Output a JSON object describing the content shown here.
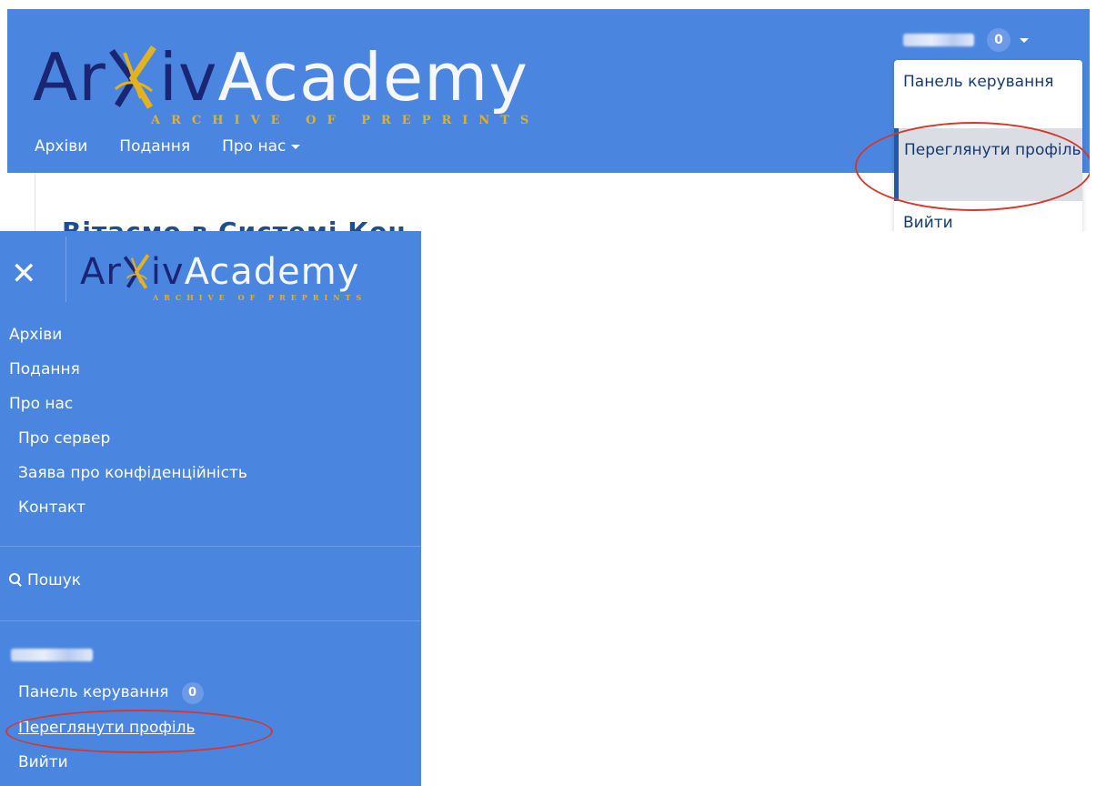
{
  "brand": {
    "name_part1": "Ar",
    "name_x": "X",
    "name_part2": "iv",
    "name_part3": "Academy",
    "tagline": "ARCHIVE OF PREPRINTS"
  },
  "top_header": {
    "nav": [
      {
        "label": "Архіви"
      },
      {
        "label": "Подання"
      },
      {
        "label": "Про нас"
      }
    ],
    "user": {
      "notification_count": "0"
    },
    "dropdown": [
      {
        "label": "Панель керування"
      },
      {
        "label": "Переглянути профіль"
      },
      {
        "label": "Вийти"
      }
    ],
    "partial_title": "Вітаємо в Системі Кон..."
  },
  "mobile_menu": {
    "close_symbol": "✕",
    "nav": [
      {
        "label": "Архіви"
      },
      {
        "label": "Подання"
      },
      {
        "label": "Про нас"
      }
    ],
    "about_submenu": [
      {
        "label": "Про сервер"
      },
      {
        "label": "Заява про конфіденційність"
      },
      {
        "label": "Контакт"
      }
    ],
    "search": {
      "label": "Пошук",
      "icon": "search-icon"
    },
    "user_menu": [
      {
        "label": "Панель керування",
        "badge": "0"
      },
      {
        "label": "Переглянути профіль"
      },
      {
        "label": "Вийти"
      }
    ]
  },
  "colors": {
    "header_blue": "#4a86e0",
    "logo_dark": "#1a2673",
    "logo_gold": "#e3b21e",
    "highlight_red": "#d4382c",
    "active_item_bg": "#dadde3"
  }
}
